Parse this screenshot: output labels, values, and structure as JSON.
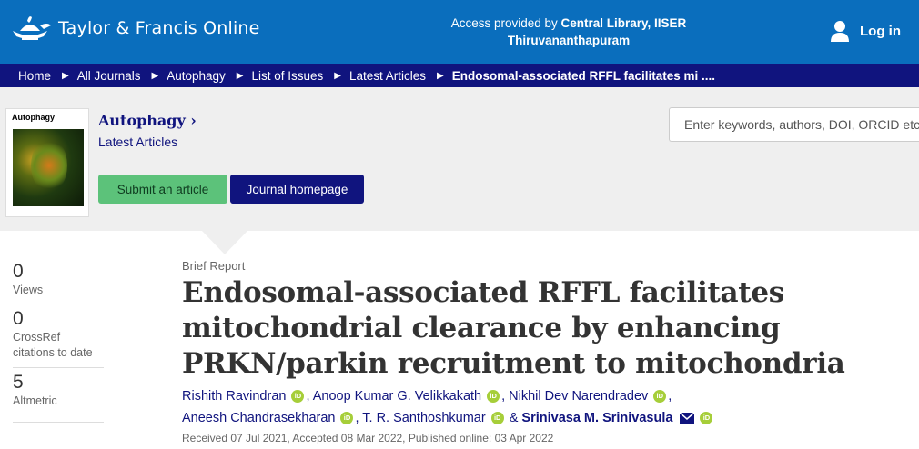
{
  "header": {
    "logo_text": "Taylor & Francis Online",
    "access_prefix": "Access provided by ",
    "access_org_line1": "Central Library, IISER",
    "access_org_line2": "Thiruvananthapuram",
    "login_label": "Log in"
  },
  "breadcrumb": [
    "Home",
    "All Journals",
    "Autophagy",
    "List of Issues",
    "Latest Articles",
    "Endosomal-associated RFFL facilitates mi ...."
  ],
  "journal": {
    "cover_title": "Autophagy",
    "name": "Autophagy",
    "name_chevron": "›",
    "subtitle": "Latest Articles",
    "submit_label": "Submit an article",
    "homepage_label": "Journal homepage"
  },
  "search": {
    "placeholder": "Enter keywords, authors, DOI, ORCID etc"
  },
  "metrics": [
    {
      "value": "0",
      "label": "Views"
    },
    {
      "value": "0",
      "label": "CrossRef citations to date"
    },
    {
      "value": "5",
      "label": "Altmetric"
    }
  ],
  "article": {
    "type": "Brief Report",
    "title": "Endosomal-associated RFFL facilitates mitochondrial clearance by enhancing PRKN/parkin recruitment to mitochondria",
    "authors": [
      "Rishith Ravindran",
      "Anoop Kumar G. Velikkakath",
      "Nikhil Dev Narendradev",
      "Aneesh Chandrasekharan",
      "T. R. Santhoshkumar",
      "Srinivasa M. Srinivasula"
    ],
    "orcid_label": "iD",
    "and_label": "&",
    "dates": "Received 07 Jul 2021, Accepted 08 Mar 2022, Published online: 03 Apr 2022"
  },
  "colors": {
    "header_blue": "#0a6ebd",
    "navy": "#10147e",
    "submit_green": "#5cc27a",
    "orcid_green": "#a6ce39"
  }
}
